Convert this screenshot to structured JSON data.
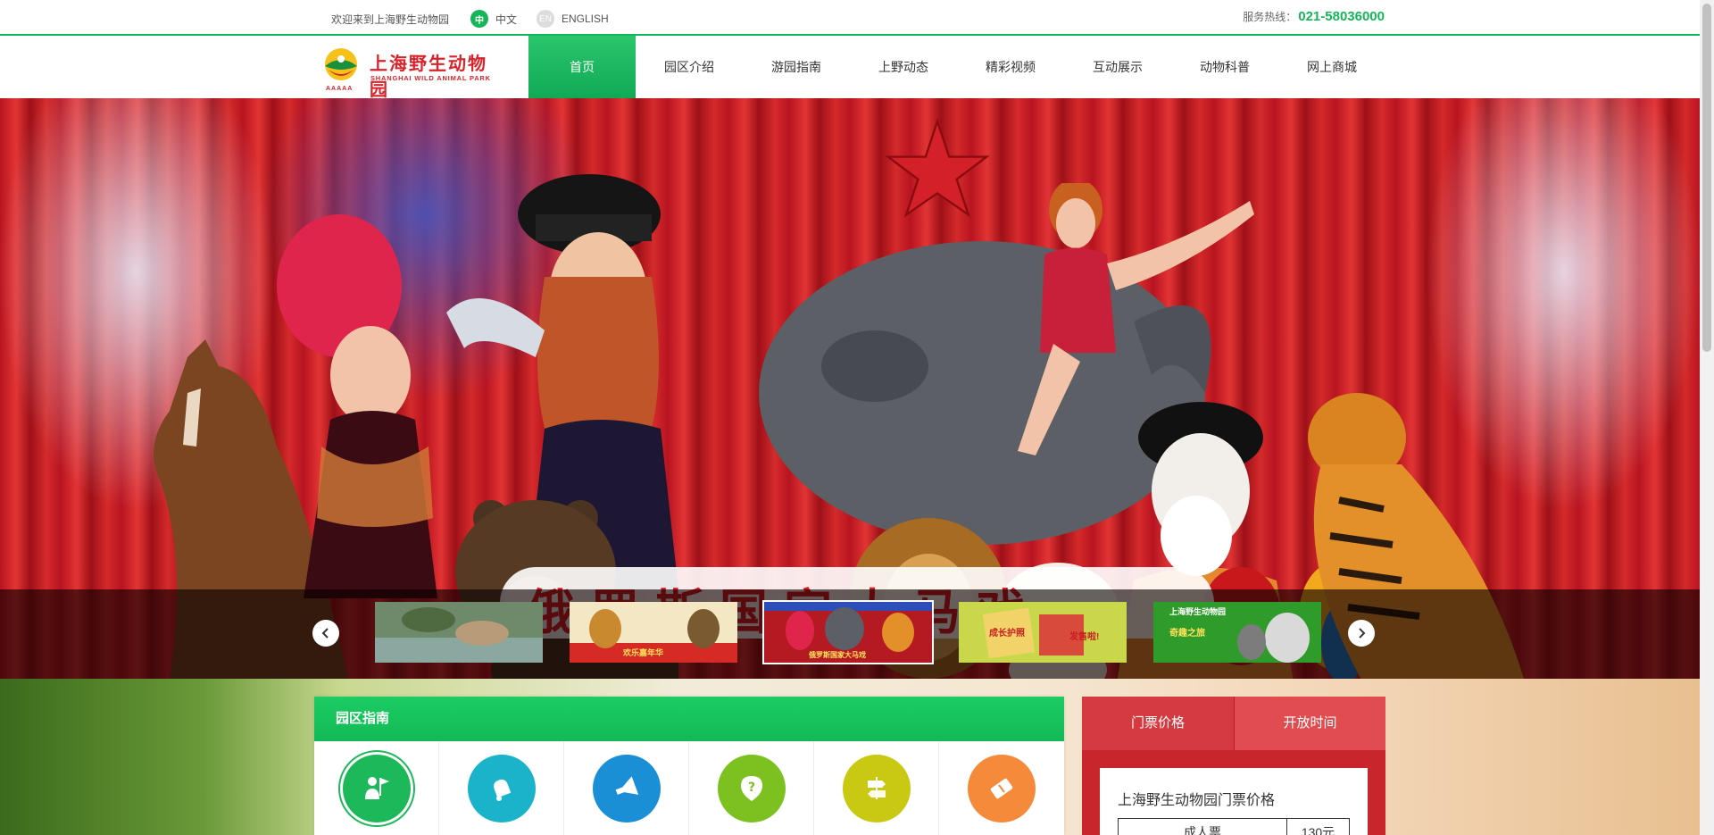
{
  "topbar": {
    "welcome": "欢迎来到上海野生动物园",
    "lang_cn_badge": "中",
    "lang_cn_label": "中文",
    "lang_en_badge": "EN",
    "lang_en_label": "ENGLISH",
    "hotline_label": "服务热线：",
    "hotline_number": "021-58036000"
  },
  "logo": {
    "name_cn": "上海野生动物园",
    "name_en": "SHANGHAI WILD ANIMAL PARK",
    "rating": "AAAAA"
  },
  "nav": {
    "items": [
      "首页",
      "园区介绍",
      "游园指南",
      "上野动态",
      "精彩视频",
      "互动展示",
      "动物科普",
      "网上商城"
    ],
    "active_index": 0
  },
  "banner": {
    "headline": "俄罗斯国家大马戏",
    "thumbnails": [
      {
        "name": "thumb-animals-pond",
        "active": false
      },
      {
        "name": "thumb-festival",
        "active": false
      },
      {
        "name": "thumb-circus",
        "active": true
      },
      {
        "name": "thumb-growth-book",
        "active": false
      },
      {
        "name": "thumb-lemur",
        "active": false
      }
    ],
    "thumb_captions": {
      "festival": "欢乐嘉年华",
      "circus": "俄罗斯国家大马戏",
      "growth": "成长护照",
      "growth_sub": "发售啦!",
      "lemur_title": "上海野生动物园",
      "lemur_sub": "奇趣之旅"
    }
  },
  "guide": {
    "title": "园区指南",
    "icons": [
      {
        "name": "visitor-guide-icon",
        "color": "#1db85a"
      },
      {
        "name": "bell-icon",
        "color": "#1bb3c9"
      },
      {
        "name": "megaphone-icon",
        "color": "#1a8fd6"
      },
      {
        "name": "help-icon",
        "color": "#7cc11f"
      },
      {
        "name": "signpost-icon",
        "color": "#c9c914"
      },
      {
        "name": "ticket-icon",
        "color": "#f58a3a"
      }
    ]
  },
  "tickets": {
    "tab_price": "门票价格",
    "tab_hours": "开放时间",
    "panel_title": "上海野生动物园门票价格",
    "row_label": "成人票",
    "row_price": "130元"
  },
  "colors": {
    "brand_green": "#16b55a",
    "brand_red": "#c8262c",
    "logo_red": "#d8232a"
  }
}
